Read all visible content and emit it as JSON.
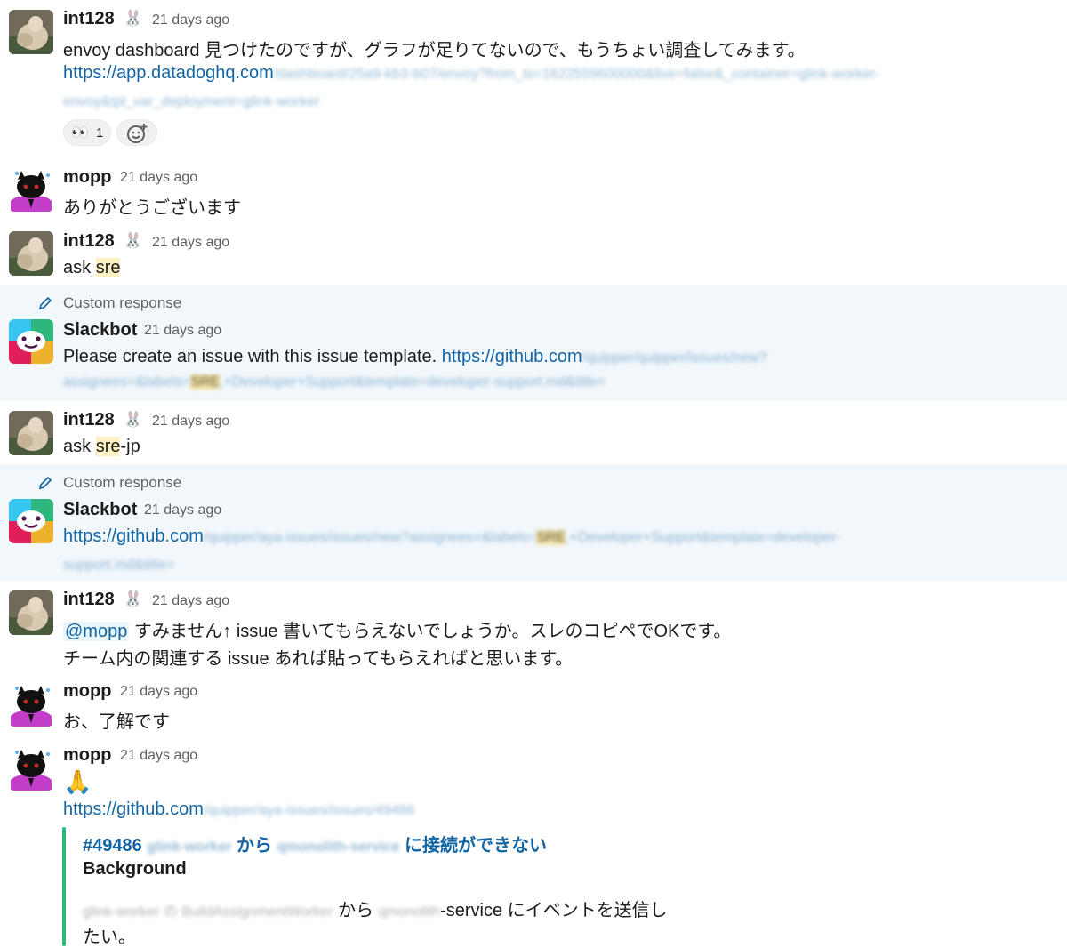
{
  "messages": [
    {
      "author": "int128",
      "rabbit": "🐰",
      "time": "21 days ago",
      "line1": "envoy dashboard 見つけたのですが、グラフが足りてないので、もうちょい調査してみます。",
      "link_visible": "https://app.datadoghq.com",
      "link_blur_1": "/dashboard/25a9-kb3-b07/envoy?from_ts=1622559600000&live=false&_container=glink-worker-",
      "link_blur_2": "envoy&tpl_var_deployment=glink-worker",
      "reaction_emoji": "👀",
      "reaction_count": "1",
      "add_reaction_icon": "add-emoji-icon"
    },
    {
      "author": "mopp",
      "time": "21 days ago",
      "text": "ありがとうございます"
    },
    {
      "author": "int128",
      "rabbit": "🐰",
      "time": "21 days ago",
      "text_prefix": "ask ",
      "text_mark": "sre"
    },
    {
      "custom_label": "Custom response",
      "author": "Slackbot",
      "time": "21 days ago",
      "text": "Please create an issue with this issue template. ",
      "link_visible": "https://github.com",
      "link_blur_1": "/quipper/quipper/issues/new?",
      "link_blur_2a": "assignees=&labels=",
      "link_blur_mark": "SRE",
      "link_blur_2b": ",+Developer+Support&template=developer-support.md&title="
    },
    {
      "author": "int128",
      "rabbit": "🐰",
      "time": "21 days ago",
      "text_prefix": "ask ",
      "text_mark": "sre",
      "text_suffix": "-jp"
    },
    {
      "custom_label": "Custom response",
      "author": "Slackbot",
      "time": "21 days ago",
      "link_visible": "https://github.com",
      "link_blur_1a": "/quipper/aya-issues/issues/new?assignees=&labels=",
      "link_blur_mark": "SRE",
      "link_blur_1b": ",+Developer+Support&template=developer-",
      "link_blur_2": "support.md&title="
    },
    {
      "author": "int128",
      "rabbit": "🐰",
      "time": "21 days ago",
      "mention": "@mopp",
      "line1": " すみません↑ issue 書いてもらえないでしょうか。スレのコピペでOKです。",
      "line2": "チーム内の関連する issue あれば貼ってもらえればと思います。"
    },
    {
      "author": "mopp",
      "time": "21 days ago",
      "text": "お、了解です"
    },
    {
      "author": "mopp",
      "time": "21 days ago",
      "emoji": "🙏",
      "link_visible": "https://github.com",
      "link_blur": "/quipper/aya-issues/issues/49486",
      "unfurl": {
        "title_num": "#49486",
        "title_blur_1": "glink-worker",
        "title_mid": "から",
        "title_blur_2": "qmonolith-service",
        "title_end": "に接続ができない",
        "heading": "Background",
        "body_blur_1": "glink-worker の BuildAssignmentWorker",
        "body_mid": " から ",
        "body_blur_2": "qmonolith",
        "body_end": "-service にイベントを送信し",
        "body_line2": "たい。"
      }
    }
  ]
}
